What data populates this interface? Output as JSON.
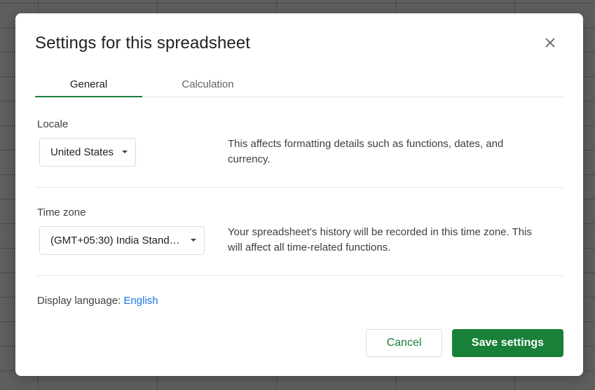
{
  "dialog": {
    "title": "Settings for this spreadsheet",
    "close_icon": "close-icon"
  },
  "tabs": [
    {
      "label": "General",
      "active": true
    },
    {
      "label": "Calculation",
      "active": false
    }
  ],
  "locale": {
    "label": "Locale",
    "value": "United States",
    "description": "This affects formatting details such as functions, dates, and currency."
  },
  "timezone": {
    "label": "Time zone",
    "value": "(GMT+05:30) India Stand…",
    "description": "Your spreadsheet's history will be recorded in this time zone. This will affect all time-related functions."
  },
  "display_language": {
    "label": "Display language:",
    "value": "English"
  },
  "buttons": {
    "cancel": "Cancel",
    "save": "Save settings"
  },
  "colors": {
    "accent": "#188038",
    "link": "#1a73e8"
  }
}
